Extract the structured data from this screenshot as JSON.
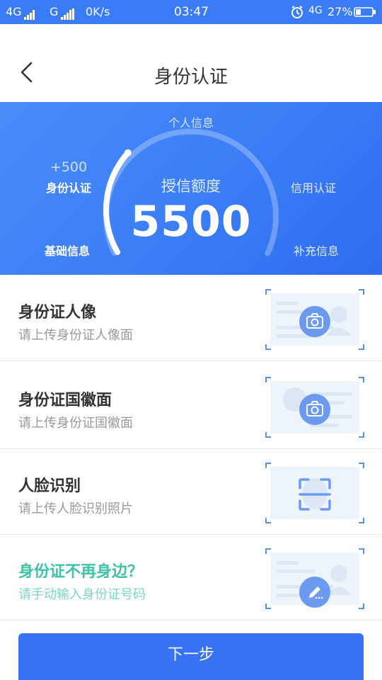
{
  "status_bar": {
    "net1": "4G",
    "net2": "G",
    "speed": "0K/s",
    "time": "03:47",
    "net3": "4G",
    "battery": "27%"
  },
  "header": {
    "title": "身份认证"
  },
  "banner": {
    "personal_info": "个人信息",
    "bonus": "+500",
    "id_auth": "身份认证",
    "credit_title": "授信额度",
    "credit_amount": "5500",
    "credit_auth": "信用认证",
    "basic_info": "基础信息",
    "supplementary_info": "补充信息",
    "gauge_progress": 0.3
  },
  "items": [
    {
      "title": "身份证人像",
      "subtitle": "请上传身份证人像面",
      "icon": "camera-icon"
    },
    {
      "title": "身份证国徽面",
      "subtitle": "请上传身份证国徽面",
      "icon": "camera-icon"
    },
    {
      "title": "人脸识别",
      "subtitle": "请上传人脸识别照片",
      "icon": "face-scan-icon"
    },
    {
      "title": "身份证不再身边？",
      "subtitle": "请手动输入身份证号码",
      "icon": "pencil-icon"
    }
  ],
  "next_button": {
    "label": "下一步"
  },
  "colors": {
    "primary": "#3a7bf7",
    "teal": "#3cc3a8",
    "card_bg": "#eef4fc",
    "icon_circle": "#6b9af0"
  }
}
